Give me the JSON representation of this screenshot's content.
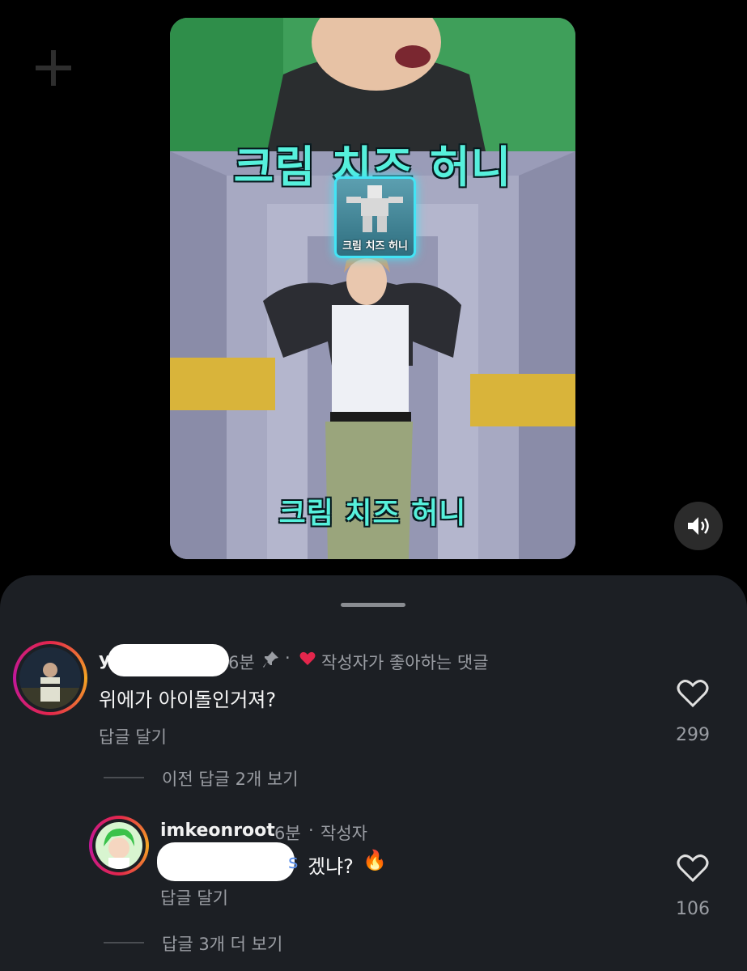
{
  "video": {
    "caption_top": "크림 치즈 허니",
    "badge_label": "크림 치즈 허니",
    "caption_bottom": "크림 치즈 허니"
  },
  "comments": [
    {
      "username": "y",
      "time": "6분",
      "liked_by_author_label": "작성자가 좋아하는 댓글",
      "text": "위에가 아이돌인거져?",
      "reply_label": "답글 달기",
      "likes": "299",
      "pinned": true
    },
    {
      "username": "imkeonroot",
      "time": "6분",
      "author_label": "작성자",
      "text_visible_prefix": "s",
      "text": "겠냐?",
      "emoji": "🔥",
      "reply_label": "답글 달기",
      "likes": "106"
    }
  ],
  "threads": {
    "previous_replies": "이전 답글 2개 보기",
    "more_replies": "답글 3개 더 보기"
  },
  "colors": {
    "background": "#000000",
    "sheet": "#1c1f24",
    "muted_text": "#9a9da3",
    "heart_red": "#e3264c",
    "caption_cyan": "#56f0dc"
  },
  "icons": [
    "plus-icon",
    "volume-icon",
    "pin-icon",
    "heart-icon",
    "fire-icon"
  ]
}
